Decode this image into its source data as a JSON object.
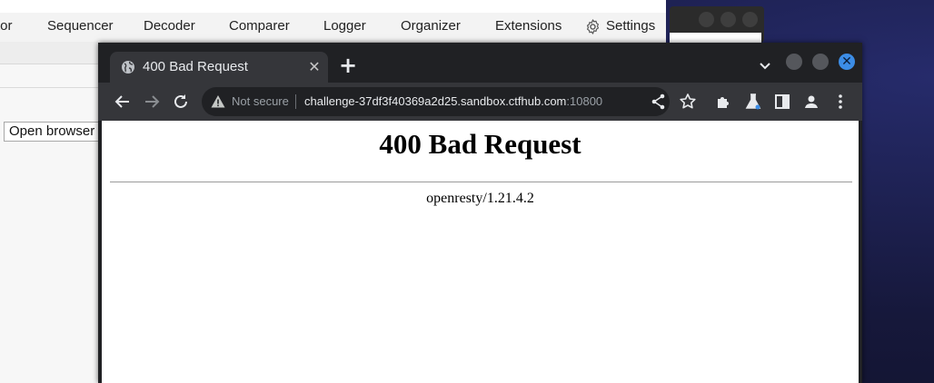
{
  "burp": {
    "tabs": [
      "tor",
      "Sequencer",
      "Decoder",
      "Comparer",
      "Logger",
      "Organizer",
      "Extensions"
    ],
    "settings_label": "Settings",
    "open_browser_label": "Open browser"
  },
  "chrome": {
    "tab_title": "400 Bad Request",
    "tab_close": "✕",
    "new_tab": "+",
    "close_glyph": "✕",
    "security_label": "Not secure",
    "url_host": "challenge-37df3f40369a2d25.sandbox.ctfhub.com",
    "url_port": ":10800"
  },
  "page": {
    "heading": "400 Bad Request",
    "server": "openresty/1.21.4.2"
  },
  "colors": {
    "chrome_frame": "#202124",
    "chrome_toolbar": "#35363a",
    "close_button": "#3c8de6"
  }
}
